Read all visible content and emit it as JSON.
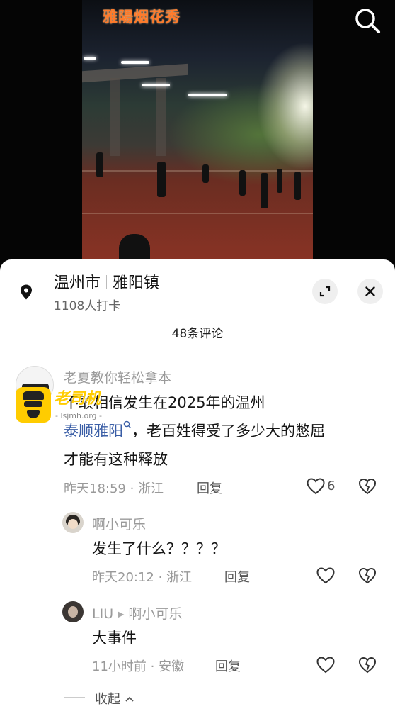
{
  "video": {
    "overlay_title": "雅陽烟花秀"
  },
  "header": {
    "search_icon": "search-icon"
  },
  "location": {
    "icon": "location-pin-icon",
    "city": "温州市",
    "town": "雅阳镇",
    "checkins": "1108人打卡"
  },
  "comments_count": "48条评论",
  "comments": [
    {
      "user": "老夏教你轻松拿本",
      "text_line1": "不敢相信发生在2025年的温州",
      "tag": "泰顺雅阳",
      "text_line2_rest": "，老百姓得受了多少大的憋屈",
      "text_line3": "才能有这种释放",
      "time": "昨天18:59",
      "region": "浙江",
      "reply": "回复",
      "likes": "6"
    },
    {
      "user": "啊小可乐",
      "text": "发生了什么？？？？",
      "time": "昨天20:12",
      "region": "浙江",
      "reply": "回复"
    },
    {
      "user": "LIU",
      "reply_to": "啊小可乐",
      "text": "大事件",
      "time": "11小时前",
      "region": "安徽",
      "reply": "回复"
    }
  ],
  "collapse_label": "收起",
  "watermark": {
    "title": "老司机",
    "url": "- lsjmh.org -"
  },
  "colors": {
    "accent_link": "#3a5ea6",
    "overlay_title": "#ff7a2a"
  }
}
